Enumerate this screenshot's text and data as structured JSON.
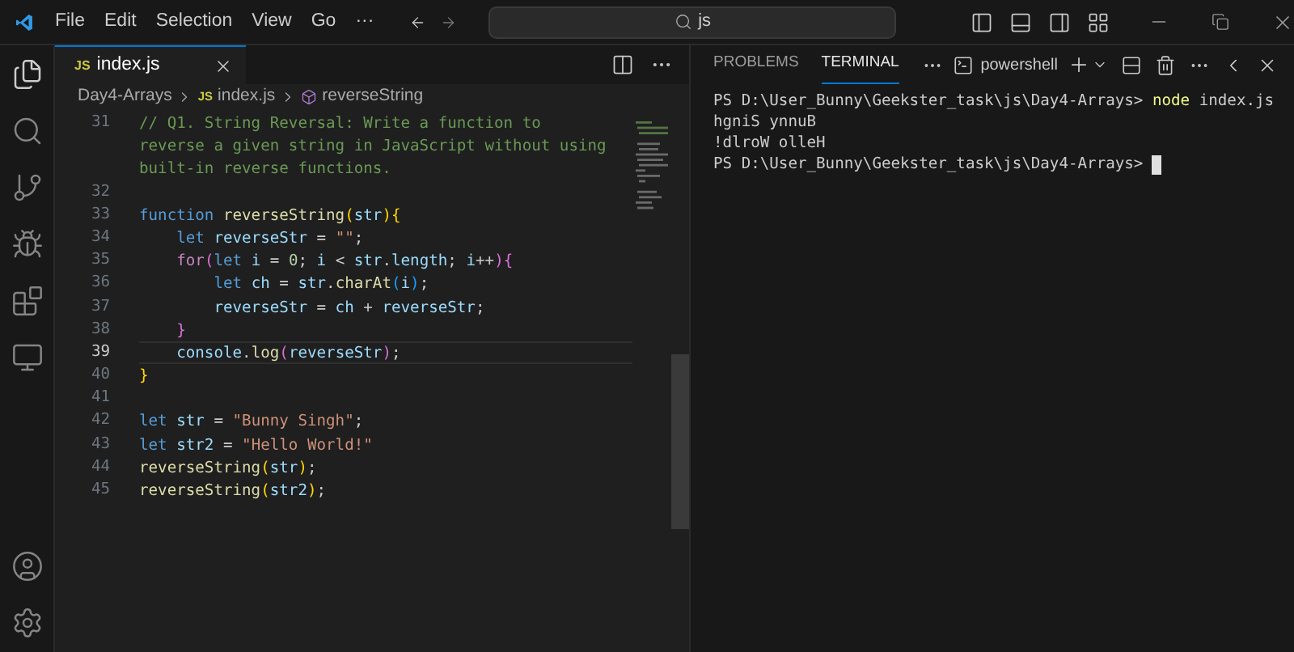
{
  "menu": [
    "File",
    "Edit",
    "Selection",
    "View",
    "Go",
    "···"
  ],
  "command_center": {
    "value": "js"
  },
  "editor_tabs": [
    {
      "label": "index.js",
      "icon_label": "JS",
      "selected": true
    }
  ],
  "breadcrumb": [
    {
      "label": "Day4-Arrays",
      "kind": "folder"
    },
    {
      "label": "index.js",
      "kind": "file",
      "icon_label": "JS"
    },
    {
      "label": "reverseString",
      "kind": "symbol"
    }
  ],
  "code_lines": [
    {
      "number": "31",
      "current": false,
      "rows": [
        [
          {
            "t": "// Q1. String Reversal: Write a function to",
            "kind": "comment"
          }
        ],
        [
          {
            "t": "reverse a given string in JavaScript without using",
            "kind": "comment"
          }
        ],
        [
          {
            "t": "built-in reverse functions.",
            "kind": "comment"
          }
        ]
      ]
    },
    {
      "number": "32",
      "current": false
    },
    {
      "number": "33",
      "current": false,
      "rows": [
        [
          {
            "t": "function ",
            "kind": "kw"
          },
          {
            "t": "reverseString",
            "kind": "fn"
          },
          {
            "t": "(",
            "kind": "b1"
          },
          {
            "t": "str",
            "kind": "var"
          },
          {
            "t": ")",
            "kind": "b1"
          },
          {
            "t": "{",
            "kind": "b1"
          }
        ]
      ]
    },
    {
      "number": "34",
      "current": false,
      "rows": [
        [
          {
            "t": "    let ",
            "kind": "kw"
          },
          {
            "t": "reverseStr",
            "kind": "var"
          },
          {
            "t": " = ",
            "kind": "plain"
          },
          {
            "t": "\"\"",
            "kind": "string"
          },
          {
            "t": ";",
            "kind": "plain"
          }
        ]
      ]
    },
    {
      "number": "35",
      "current": false,
      "rows": [
        [
          {
            "t": "    for",
            "kind": "ctl"
          },
          {
            "t": "(",
            "kind": "b2"
          },
          {
            "t": "let ",
            "kind": "kw"
          },
          {
            "t": "i",
            "kind": "var"
          },
          {
            "t": " = ",
            "kind": "plain"
          },
          {
            "t": "0",
            "kind": "num"
          },
          {
            "t": "; ",
            "kind": "plain"
          },
          {
            "t": "i",
            "kind": "var"
          },
          {
            "t": " < ",
            "kind": "plain"
          },
          {
            "t": "str",
            "kind": "var"
          },
          {
            "t": ".",
            "kind": "plain"
          },
          {
            "t": "length",
            "kind": "var"
          },
          {
            "t": "; ",
            "kind": "plain"
          },
          {
            "t": "i",
            "kind": "var"
          },
          {
            "t": "++",
            "kind": "plain"
          },
          {
            "t": ")",
            "kind": "b2"
          },
          {
            "t": "{",
            "kind": "b2"
          }
        ]
      ]
    },
    {
      "number": "36",
      "current": false,
      "rows": [
        [
          {
            "t": "        let ",
            "kind": "kw"
          },
          {
            "t": "ch",
            "kind": "var"
          },
          {
            "t": " = ",
            "kind": "plain"
          },
          {
            "t": "str",
            "kind": "var"
          },
          {
            "t": ".",
            "kind": "plain"
          },
          {
            "t": "charAt",
            "kind": "fn"
          },
          {
            "t": "(",
            "kind": "b3"
          },
          {
            "t": "i",
            "kind": "var"
          },
          {
            "t": ")",
            "kind": "b3"
          },
          {
            "t": ";",
            "kind": "plain"
          }
        ]
      ]
    },
    {
      "number": "37",
      "current": false,
      "rows": [
        [
          {
            "t": "        reverseStr",
            "kind": "var"
          },
          {
            "t": " = ",
            "kind": "plain"
          },
          {
            "t": "ch",
            "kind": "var"
          },
          {
            "t": " + ",
            "kind": "plain"
          },
          {
            "t": "reverseStr",
            "kind": "var"
          },
          {
            "t": ";",
            "kind": "plain"
          }
        ]
      ]
    },
    {
      "number": "38",
      "current": false,
      "rows": [
        [
          {
            "t": "    }",
            "kind": "b2"
          }
        ]
      ]
    },
    {
      "number": "39",
      "current": true,
      "rows": [
        [
          {
            "t": "    console",
            "kind": "var"
          },
          {
            "t": ".",
            "kind": "plain"
          },
          {
            "t": "log",
            "kind": "fn"
          },
          {
            "t": "(",
            "kind": "b2"
          },
          {
            "t": "reverseStr",
            "kind": "var"
          },
          {
            "t": ")",
            "kind": "b2"
          },
          {
            "t": ";",
            "kind": "plain"
          }
        ]
      ]
    },
    {
      "number": "40",
      "current": false,
      "rows": [
        [
          {
            "t": "}",
            "kind": "b1"
          }
        ]
      ]
    },
    {
      "number": "41",
      "current": false
    },
    {
      "number": "42",
      "current": false,
      "rows": [
        [
          {
            "t": "let ",
            "kind": "kw"
          },
          {
            "t": "str",
            "kind": "var"
          },
          {
            "t": " = ",
            "kind": "plain"
          },
          {
            "t": "\"Bunny Singh\"",
            "kind": "string"
          },
          {
            "t": ";",
            "kind": "plain"
          }
        ]
      ]
    },
    {
      "number": "43",
      "current": false,
      "rows": [
        [
          {
            "t": "let ",
            "kind": "kw"
          },
          {
            "t": "str2",
            "kind": "var"
          },
          {
            "t": " = ",
            "kind": "plain"
          },
          {
            "t": "\"Hello World!\"",
            "kind": "string"
          }
        ]
      ]
    },
    {
      "number": "44",
      "current": false,
      "rows": [
        [
          {
            "t": "reverseString",
            "kind": "fn"
          },
          {
            "t": "(",
            "kind": "b1"
          },
          {
            "t": "str",
            "kind": "var"
          },
          {
            "t": ")",
            "kind": "b1"
          },
          {
            "t": ";",
            "kind": "plain"
          }
        ]
      ]
    },
    {
      "number": "45",
      "current": false,
      "rows": [
        [
          {
            "t": "reverseString",
            "kind": "fn"
          },
          {
            "t": "(",
            "kind": "b1"
          },
          {
            "t": "str2",
            "kind": "var"
          },
          {
            "t": ")",
            "kind": "b1"
          },
          {
            "t": ";",
            "kind": "plain"
          }
        ]
      ]
    }
  ],
  "panel_tabs": [
    {
      "label": "PROBLEMS",
      "selected": false
    },
    {
      "label": "TERMINAL",
      "selected": true
    }
  ],
  "terminal_shell": "powershell",
  "terminal_lines": [
    {
      "cursor": false,
      "tokens": [
        {
          "t": "PS D:\\User_Bunny\\Geekster_task\\js\\Day4-Arrays> ",
          "kind": "plain"
        },
        {
          "t": "node",
          "kind": "cmd"
        },
        {
          "t": " index.js",
          "kind": "plain"
        }
      ]
    },
    {
      "cursor": false,
      "tokens": [
        {
          "t": "hgniS ynnuB",
          "kind": "plain"
        }
      ]
    },
    {
      "cursor": false,
      "tokens": [
        {
          "t": "!dlroW olleH",
          "kind": "plain"
        }
      ]
    },
    {
      "cursor": true,
      "tokens": [
        {
          "t": "PS D:\\User_Bunny\\Geekster_task\\js\\Day4-Arrays> ",
          "kind": "plain"
        }
      ]
    }
  ]
}
